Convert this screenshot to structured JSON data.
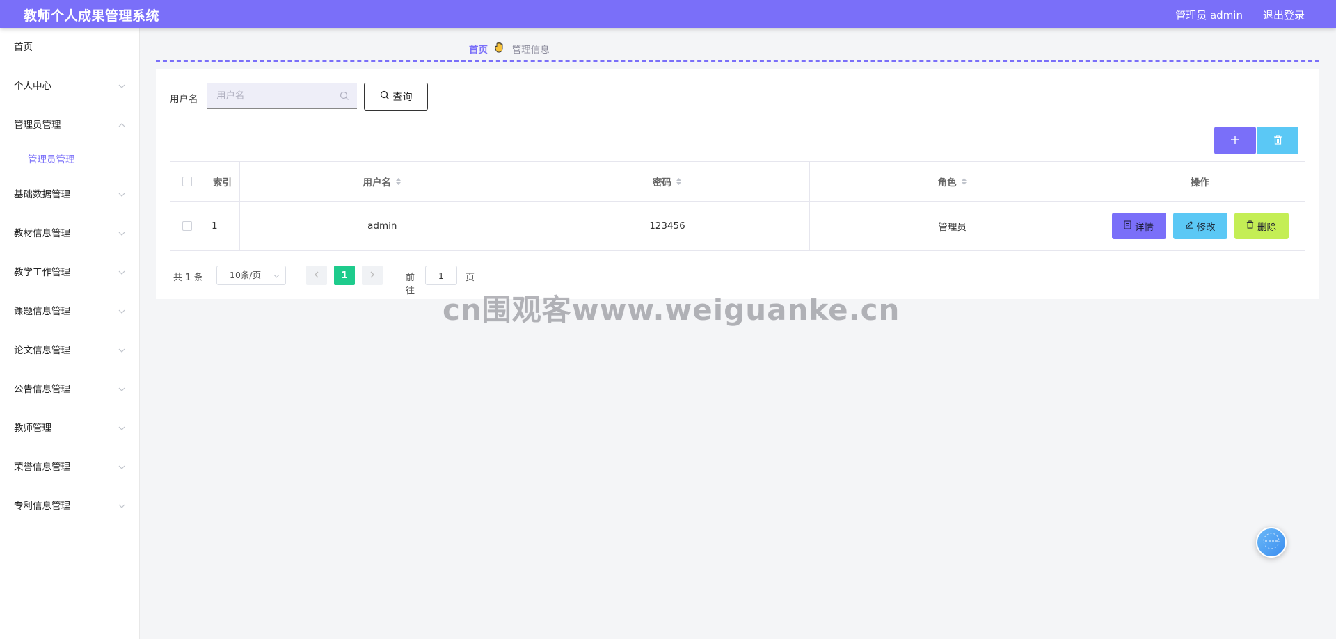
{
  "header": {
    "title": "教师个人成果管理系统",
    "user": "管理员 admin",
    "logout": "退出登录"
  },
  "sidebar": {
    "items": [
      {
        "label": "首页",
        "has_children": false
      },
      {
        "label": "个人中心",
        "has_children": true,
        "expanded": false
      },
      {
        "label": "管理员管理",
        "has_children": true,
        "expanded": true,
        "children": [
          "管理员管理"
        ]
      },
      {
        "label": "基础数据管理",
        "has_children": true,
        "expanded": false
      },
      {
        "label": "教材信息管理",
        "has_children": true,
        "expanded": false
      },
      {
        "label": "教学工作管理",
        "has_children": true,
        "expanded": false
      },
      {
        "label": "课题信息管理",
        "has_children": true,
        "expanded": false
      },
      {
        "label": "论文信息管理",
        "has_children": true,
        "expanded": false
      },
      {
        "label": "公告信息管理",
        "has_children": true,
        "expanded": false
      },
      {
        "label": "教师管理",
        "has_children": true,
        "expanded": false
      },
      {
        "label": "荣誉信息管理",
        "has_children": true,
        "expanded": false
      },
      {
        "label": "专利信息管理",
        "has_children": true,
        "expanded": false
      }
    ]
  },
  "breadcrumb": {
    "home": "首页",
    "current": "管理信息"
  },
  "search": {
    "label": "用户名",
    "placeholder": "用户名",
    "button": "查询"
  },
  "table": {
    "columns": [
      "索引",
      "用户名",
      "密码",
      "角色",
      "操作"
    ],
    "rows": [
      {
        "index": "1",
        "username": "admin",
        "password": "123456",
        "role": "管理员"
      }
    ],
    "actions": {
      "detail": "详情",
      "edit": "修改",
      "delete": "删除"
    }
  },
  "pagination": {
    "total": "共 1 条",
    "page_size": "10条/页",
    "current_page": "1",
    "goto_label": "前往",
    "goto_value": "1",
    "goto_suffix": "页"
  },
  "watermark": "cn围观客www.weiguanke.cn",
  "colors": {
    "primary": "#7a6ff9",
    "info": "#5bc8f5",
    "warning": "#c4ee55",
    "pager_active": "#1ecb8c"
  }
}
